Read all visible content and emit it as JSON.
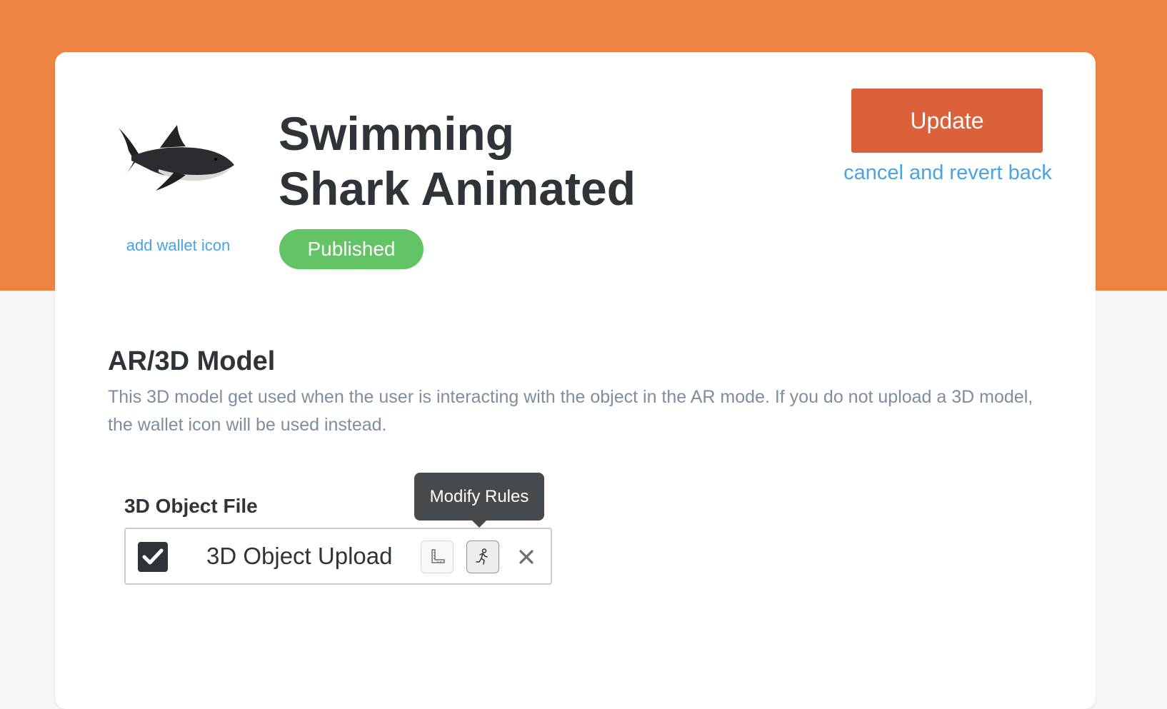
{
  "asset": {
    "title_line1": "Swimming",
    "title_line2": "Shark Animated",
    "status": "Published",
    "add_wallet_icon_label": "add wallet icon",
    "thumbnail_icon": "shark-thumbnail"
  },
  "actions": {
    "update_label": "Update",
    "cancel_label": "cancel and revert back"
  },
  "model_section": {
    "title": "AR/3D Model",
    "description": "This 3D model get used when the user is interacting with the object in the AR mode. If you do not upload a 3D model, the wallet icon will be used instead."
  },
  "file_field": {
    "label": "3D Object File",
    "file_name": "3D Object Upload",
    "checked": true,
    "icons": [
      "ruler-icon",
      "person-running-icon",
      "close-icon"
    ],
    "tooltip": "Modify Rules"
  },
  "colors": {
    "header_band": "#ee8442",
    "update_button": "#da613a",
    "link": "#4aa3e6",
    "published_badge": "#62c465",
    "tooltip": "#474a4d"
  }
}
